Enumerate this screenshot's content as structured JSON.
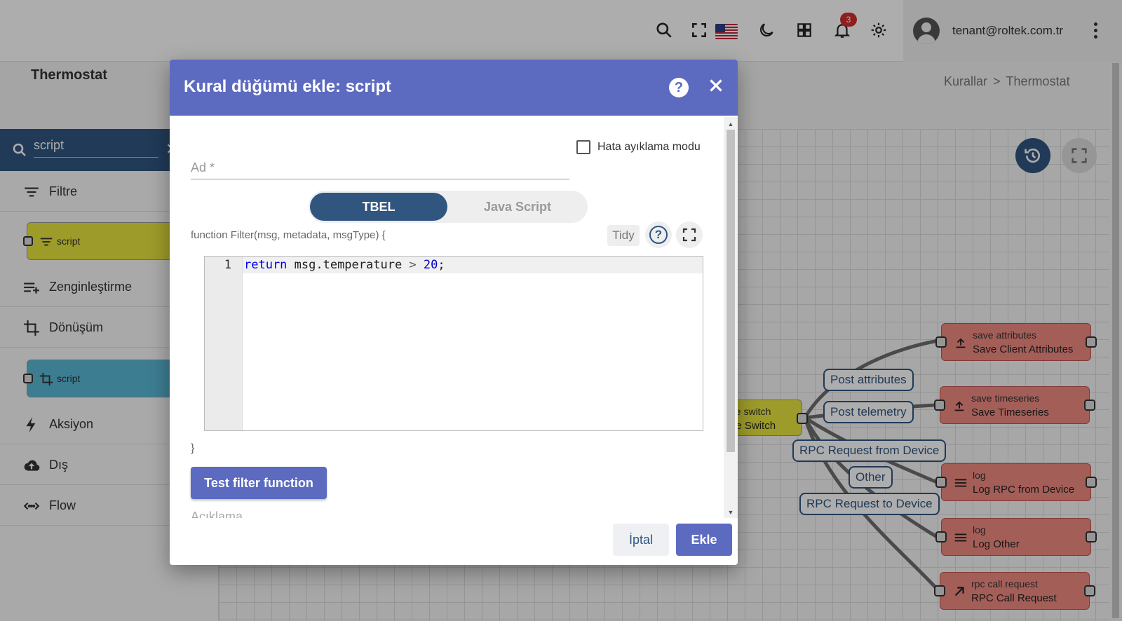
{
  "header": {
    "icons": [
      "search-icon",
      "fullscreen-icon",
      "us-flag-icon",
      "dark-mode-icon",
      "dashboard-grid-icon",
      "notifications-icon",
      "settings-icon"
    ],
    "notification_count": "3",
    "user_email": "tenant@roltek.com.tr"
  },
  "page": {
    "title": "Thermostat",
    "breadcrumb": [
      "Kurallar",
      ">",
      "Thermostat"
    ]
  },
  "sidebar": {
    "search_value": "script",
    "categories": [
      {
        "label": "Filtre",
        "icon": "filter-icon"
      },
      {
        "label": "Zenginleştirme",
        "icon": "enrichment-icon"
      },
      {
        "label": "Dönüşüm",
        "icon": "crop-icon"
      },
      {
        "label": "Aksiyon",
        "icon": "lightning-icon"
      },
      {
        "label": "Dış",
        "icon": "cloud-upload-icon"
      },
      {
        "label": "Flow",
        "icon": "code-arrows-icon"
      }
    ],
    "nodes": [
      {
        "label": "script",
        "color": "#e7e53f"
      },
      {
        "label": "script",
        "color": "#5ab8d8"
      }
    ]
  },
  "canvas": {
    "switch_node": {
      "type": "pe switch",
      "name": "pe Switch"
    },
    "nodes": [
      {
        "type": "save attributes",
        "name": "Save Client Attributes"
      },
      {
        "type": "save timeseries",
        "name": "Save Timeseries"
      },
      {
        "type": "log",
        "name": "Log RPC from Device"
      },
      {
        "type": "log",
        "name": "Log Other"
      },
      {
        "type": "rpc call request",
        "name": "RPC Call Request"
      }
    ],
    "edges": [
      "Post attributes",
      "Post telemetry",
      "RPC Request from Device",
      "Other",
      "RPC Request to Device"
    ],
    "node_color": "#f28b82"
  },
  "dialog": {
    "title": "Kural düğümü ekle: script",
    "debug_label": "Hata ayıklama modu",
    "debug_checked": false,
    "name_placeholder": "Ad *",
    "name_value": "",
    "lang_tabs": [
      "TBEL",
      "Java Script"
    ],
    "selected_lang": "TBEL",
    "function_signature": "function Filter(msg, metadata, msgType) {",
    "tidy_label": "Tidy",
    "code_line_number": "1",
    "code": {
      "kw": "return",
      "mid": " msg.temperature ",
      "op": ">",
      "num": "20",
      "end": ";"
    },
    "closing_brace": "}",
    "test_button": "Test filter function",
    "description_label": "Açıklama",
    "cancel_button": "İptal",
    "add_button": "Ekle",
    "accent_color": "#5c6bc0",
    "primary_color": "#305680"
  }
}
